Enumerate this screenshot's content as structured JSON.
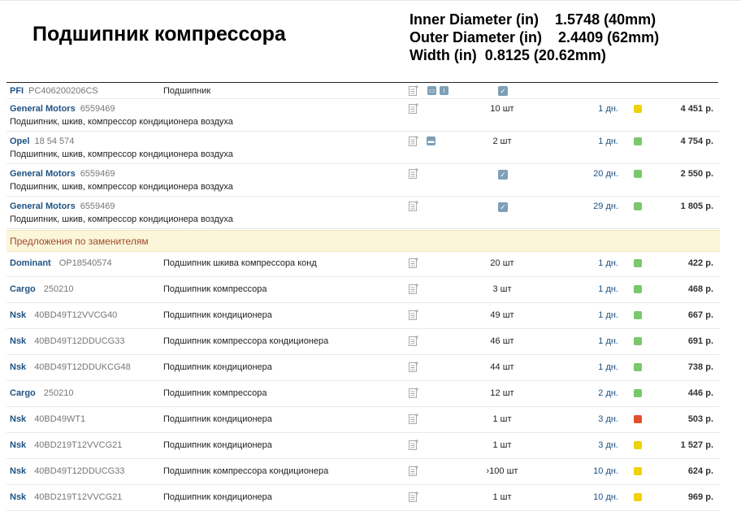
{
  "page": {
    "title": "Подшипник компрессора",
    "specs": [
      "Inner Diameter (in)    1.5748 (40mm)",
      "Outer Diameter (in)    2.4409 (62mm)",
      "Width (in)  0.8125 (20.62mm)"
    ]
  },
  "colors": {
    "green": "#7ac86c",
    "yellow": "#f0d20a",
    "red": "#e0502e",
    "link": "#1d5284"
  },
  "header_row": {
    "brand": "PFI",
    "article": "PC406200206CS",
    "description": "Подшипник"
  },
  "offers": [
    {
      "brand": "General Motors",
      "article": "6559469",
      "description": "Подшипник, шкив, компрессор кондиционера воздуха",
      "qty": "10 шт",
      "days": "1 дн.",
      "status": "yellow",
      "price": "4 451 р."
    },
    {
      "brand": "Opel",
      "article": "18 54 574",
      "description": "Подшипник, шкив, компрессор кондиционера воздуха",
      "qty": "2 шт",
      "days": "1 дн.",
      "status": "green",
      "price": "4 754 р."
    },
    {
      "brand": "General Motors",
      "article": "6559469",
      "description": "Подшипник, шкив, компрессор кондиционера воздуха",
      "qty": "",
      "days": "20 дн.",
      "status": "green",
      "price": "2 550 р."
    },
    {
      "brand": "General Motors",
      "article": "6559469",
      "description": "Подшипник, шкив, компрессор кондиционера воздуха",
      "qty": "",
      "days": "29 дн.",
      "status": "green",
      "price": "1 805 р."
    }
  ],
  "section_label": "Предложения по заменителям",
  "substitutes": [
    {
      "brand": "Dominant",
      "article": "OP18540574",
      "description": "Подшипник шкива компрессора конд",
      "qty": "20 шт",
      "days": "1 дн.",
      "status": "green",
      "price": "422 р."
    },
    {
      "brand": "Cargo",
      "article": "250210",
      "description": "Подшипник компрессора",
      "qty": "3 шт",
      "days": "1 дн.",
      "status": "green",
      "price": "468 р."
    },
    {
      "brand": "Nsk",
      "article": "40BD49T12VVCG40",
      "description": "Подшипник кондиционера",
      "qty": "49 шт",
      "days": "1 дн.",
      "status": "green",
      "price": "667 р."
    },
    {
      "brand": "Nsk",
      "article": "40BD49T12DDUCG33",
      "description": "Подшипник компрессора кондиционера",
      "qty": "46 шт",
      "days": "1 дн.",
      "status": "green",
      "price": "691 р."
    },
    {
      "brand": "Nsk",
      "article": "40BD49T12DDUKCG48",
      "description": "Подшипник кондиционера",
      "qty": "44 шт",
      "days": "1 дн.",
      "status": "green",
      "price": "738 р."
    },
    {
      "brand": "Cargo",
      "article": "250210",
      "description": "Подшипник компрессора",
      "qty": "12 шт",
      "days": "2 дн.",
      "status": "green",
      "price": "446 р."
    },
    {
      "brand": "Nsk",
      "article": "40BD49WT1",
      "description": "Подшипник кондиционера",
      "qty": "1 шт",
      "days": "3 дн.",
      "status": "red",
      "price": "503 р."
    },
    {
      "brand": "Nsk",
      "article": "40BD219T12VVCG21",
      "description": "Подшипник кондиционера",
      "qty": "1 шт",
      "days": "3 дн.",
      "status": "yellow",
      "price": "1 527 р."
    },
    {
      "brand": "Nsk",
      "article": "40BD49T12DDUCG33",
      "description": "Подшипник компрессора кондиционера",
      "qty": "›100 шт",
      "days": "10 дн.",
      "status": "yellow",
      "price": "624 р."
    },
    {
      "brand": "Nsk",
      "article": "40BD219T12VVCG21",
      "description": "Подшипник кондиционера",
      "qty": "1 шт",
      "days": "10 дн.",
      "status": "yellow",
      "price": "969 р."
    }
  ]
}
